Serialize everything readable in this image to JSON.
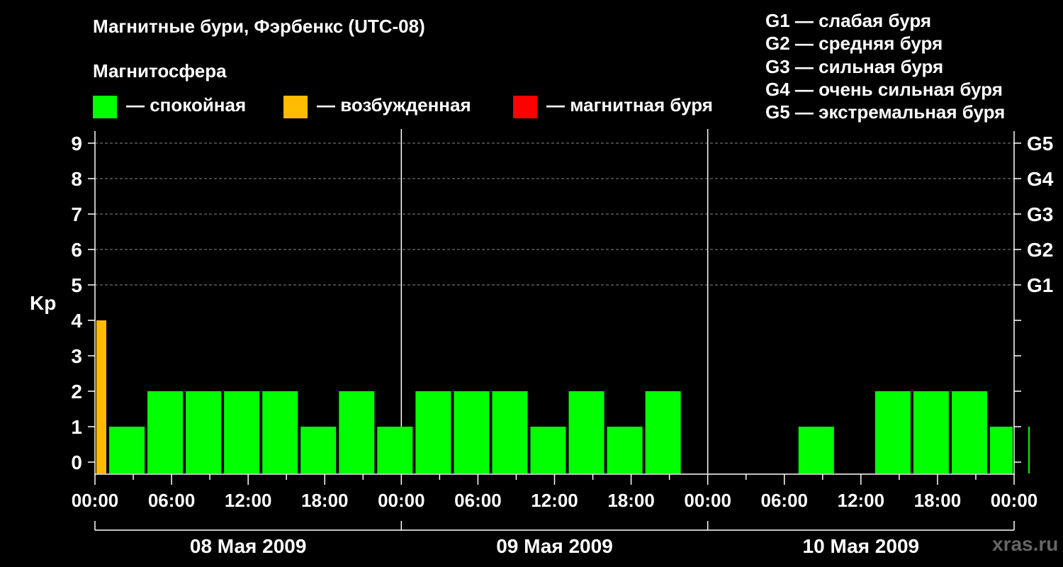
{
  "chart_data": {
    "type": "bar",
    "title": "Магнитные бури, Фэрбенкс (UTC-08)",
    "subtitle": "Магнитосфера",
    "ylabel": "Kp",
    "ylim": [
      0,
      9
    ],
    "y_ticks": [
      "0",
      "1",
      "2",
      "3",
      "4",
      "5",
      "6",
      "7",
      "8",
      "9"
    ],
    "g_ticks": [
      {
        "kp": 5,
        "label": "G1"
      },
      {
        "kp": 6,
        "label": "G2"
      },
      {
        "kp": 7,
        "label": "G3"
      },
      {
        "kp": 8,
        "label": "G4"
      },
      {
        "kp": 9,
        "label": "G5"
      }
    ],
    "x_tick_labels": [
      "00:00",
      "06:00",
      "12:00",
      "18:00",
      "00:00",
      "06:00",
      "12:00",
      "18:00",
      "00:00",
      "06:00",
      "12:00",
      "18:00",
      "00:00"
    ],
    "days": [
      "08 Мая 2009",
      "09 Мая 2009",
      "10 Мая 2009"
    ],
    "grid": "dashed horizontal at Kp 5–9",
    "bars": [
      {
        "start_hour": 0,
        "end_hour": 1,
        "kp": 4
      },
      {
        "start_hour": 1,
        "end_hour": 4,
        "kp": 1
      },
      {
        "start_hour": 4,
        "end_hour": 7,
        "kp": 2
      },
      {
        "start_hour": 7,
        "end_hour": 10,
        "kp": 2
      },
      {
        "start_hour": 10,
        "end_hour": 13,
        "kp": 2
      },
      {
        "start_hour": 13,
        "end_hour": 16,
        "kp": 2
      },
      {
        "start_hour": 16,
        "end_hour": 19,
        "kp": 1
      },
      {
        "start_hour": 19,
        "end_hour": 22,
        "kp": 2
      },
      {
        "start_hour": 22,
        "end_hour": 25,
        "kp": 1
      },
      {
        "start_hour": 25,
        "end_hour": 28,
        "kp": 2
      },
      {
        "start_hour": 28,
        "end_hour": 31,
        "kp": 2
      },
      {
        "start_hour": 31,
        "end_hour": 34,
        "kp": 2
      },
      {
        "start_hour": 34,
        "end_hour": 37,
        "kp": 1
      },
      {
        "start_hour": 37,
        "end_hour": 40,
        "kp": 2
      },
      {
        "start_hour": 40,
        "end_hour": 43,
        "kp": 1
      },
      {
        "start_hour": 43,
        "end_hour": 46,
        "kp": 2
      },
      {
        "start_hour": 55,
        "end_hour": 58,
        "kp": 1
      },
      {
        "start_hour": 61,
        "end_hour": 64,
        "kp": 2
      },
      {
        "start_hour": 64,
        "end_hour": 67,
        "kp": 2
      },
      {
        "start_hour": 67,
        "end_hour": 70,
        "kp": 2
      },
      {
        "start_hour": 70,
        "end_hour": 73,
        "kp": 1
      },
      {
        "start_hour": 73,
        "end_hour": 72.0,
        "kp": 1
      }
    ]
  },
  "legend": {
    "items": [
      {
        "label": "— спокойная",
        "color": "#00ff00"
      },
      {
        "label": "— возбужденная",
        "color": "#ffbb00"
      },
      {
        "label": "— магнитная буря",
        "color": "#ff0000"
      }
    ],
    "levels": [
      "G1 — слабая буря",
      "G2 — средняя буря",
      "G3 — сильная буря",
      "G4 — очень сильная буря",
      "G5 — экстремальная буря"
    ]
  },
  "colors": {
    "quiet": "#00ff00",
    "excited": "#ffbb00",
    "storm": "#ff0000",
    "background": "#000000",
    "watermark": "#666666"
  },
  "watermark": "xras.ru"
}
